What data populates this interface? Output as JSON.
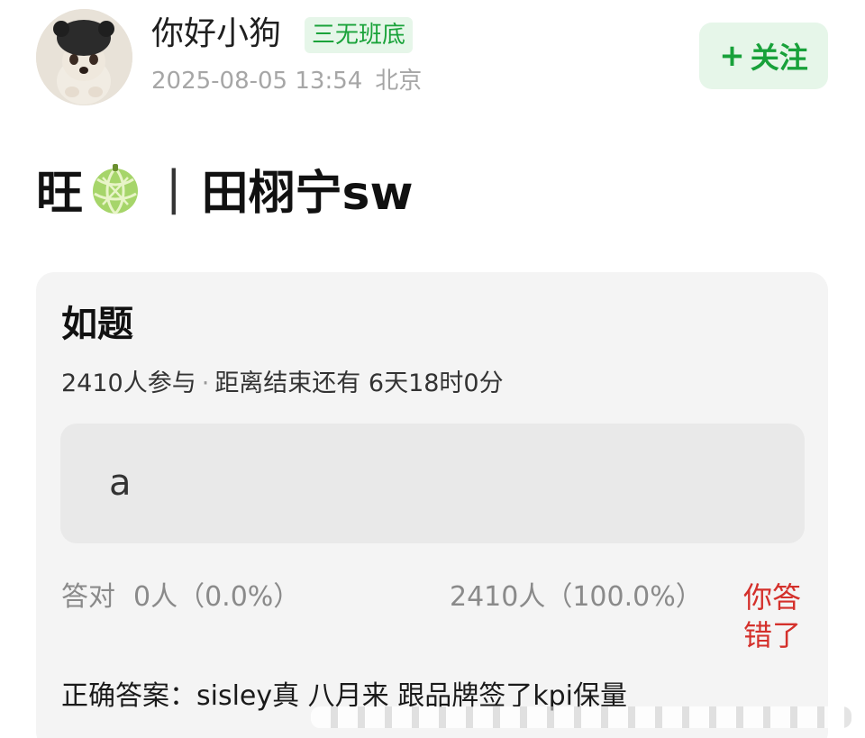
{
  "header": {
    "username": "你好小狗",
    "badge": "三无班底",
    "datetime": "2025-08-05 13:54",
    "location": "北京",
    "follow_label": "关注",
    "follow_icon": "plus-icon"
  },
  "post": {
    "title_prefix": "旺",
    "title_emoji": "melon-icon",
    "separator": "|",
    "title_suffix": "田栩宁sw"
  },
  "quiz": {
    "question": "如题",
    "participants": "2410人参与",
    "dot": "·",
    "remaining": "距离结束还有 6天18时0分",
    "option": "a",
    "correct_label": "答对",
    "correct_count": "0人（0.0%）",
    "wrong_count": "2410人（100.0%）",
    "wrong_badge": "你答错了",
    "answer": "正确答案：sisley真 八月来 跟品牌签了kpi保量"
  },
  "colors": {
    "accent_green": "#18a13a",
    "badge_bg": "#e6f6e9",
    "error_red": "#d4302b",
    "card_bg": "#f4f4f4"
  }
}
